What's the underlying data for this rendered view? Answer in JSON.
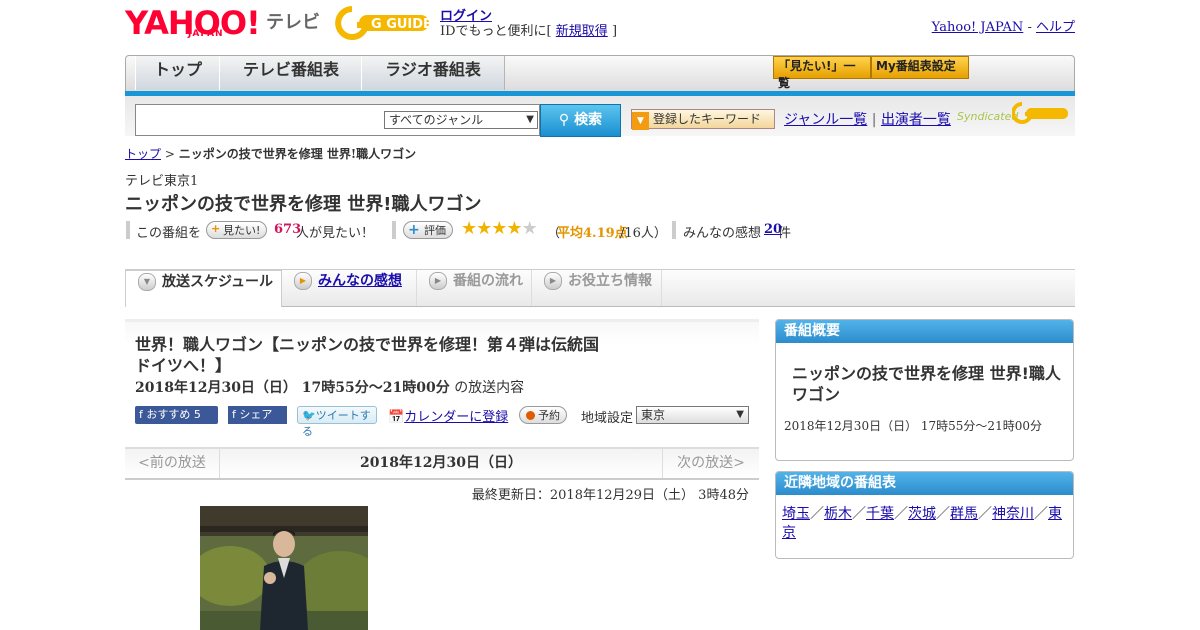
{
  "header": {
    "yahoo_logo": "YAHOO!",
    "yahoo_sub": "JAPAN",
    "tv_label": "テレビ",
    "gguide_logo": "G GUIDE",
    "login_link": "ログイン",
    "login_note_prefix": "IDでもっと便利に[",
    "signup_link": "新規取得",
    "login_note_suffix": "]",
    "yahoo_japan_link": "Yahoo! JAPAN",
    "separator": "-",
    "help_link": "ヘルプ"
  },
  "nav": {
    "tabs": [
      "トップ",
      "テレビ番組表",
      "ラジオ番組表"
    ],
    "mitai_list": "「見たい!」一覧",
    "my_bangumi": "My番組表設定"
  },
  "search": {
    "genre_select": "すべてのジャンル",
    "search_button": "検索",
    "keyword_button": "登録したキーワード",
    "genre_list": "ジャンル一覧",
    "divider": "|",
    "cast_list": "出演者一覧",
    "syndicated": "Syndicated"
  },
  "breadcrumb": {
    "home": "トップ",
    "sep": ">",
    "current": "ニッポンの技で世界を修理 世界!職人ワゴン"
  },
  "program": {
    "channel": "テレビ東京1",
    "title": "ニッポンの技で世界を修理 世界!職人ワゴン",
    "kono_bangumi": "この番組を",
    "mitai_btn": "見たい!",
    "mitai_count": "673",
    "mitai_suffix": "人が見たい！",
    "hyoka_btn": "評価",
    "rating_stars": 4,
    "rating_open": "（",
    "rating_avg": "平均4.19点",
    "rating_people": "/16人）",
    "kanso_label": "みんなの感想",
    "kanso_count": "20",
    "kanso_suffix": "件"
  },
  "tabs": [
    "放送スケジュール",
    "みんなの感想",
    "番組の流れ",
    "お役立ち情報"
  ],
  "episode": {
    "title": "世界！職人ワゴン【ニッポンの技で世界を修理！第４弾は伝統国ドイツへ！】",
    "datetime": "2018年12月30日（日） 17時55分～21時00分",
    "datetime_suffix": "の放送内容",
    "fb_recommend": "おすすめ",
    "fb_recommend_count": "5",
    "fb_share": "シェア",
    "tweet": "ツイートする",
    "calendar": "カレンダーに登録",
    "reserve": "予約",
    "region_label": "地域設定",
    "region_value": "東京"
  },
  "datenav": {
    "prev": "<前の放送",
    "current": "2018年12月30日（日）",
    "next": "次の放送>"
  },
  "updated": "最終更新日：2018年12月29日（土） 3時48分",
  "overview": {
    "header": "番組概要",
    "title": "ニッポンの技で世界を修理 世界!職人ワゴン",
    "time": "2018年12月30日（日） 17時55分～21時00分"
  },
  "nearby": {
    "header": "近隣地域の番組表",
    "areas": [
      "埼玉",
      "栃木",
      "千葉",
      "茨城",
      "群馬",
      "神奈川",
      "東京"
    ],
    "sep": "／"
  },
  "colors": {
    "accent_blue": "#1996d6",
    "yahoo_red": "#ff0033",
    "link": "#1a0dab",
    "star": "#f0b400"
  }
}
